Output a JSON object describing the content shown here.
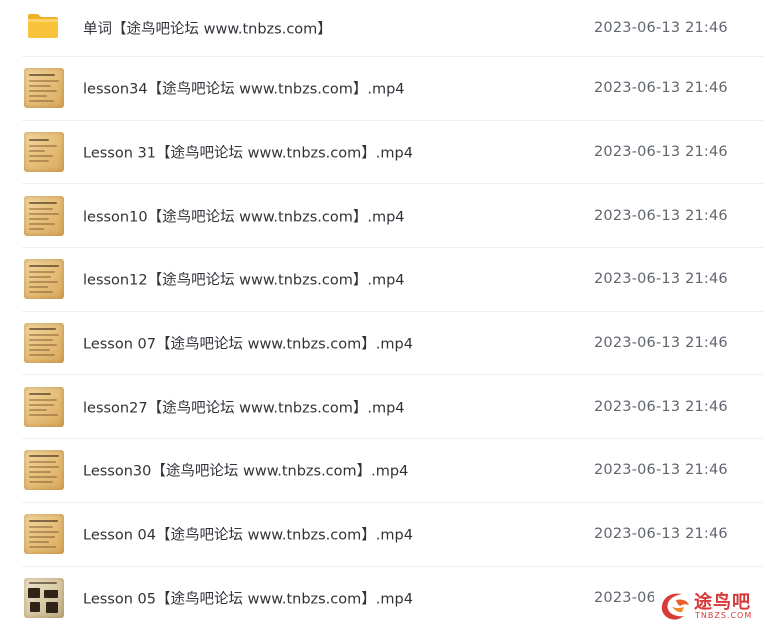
{
  "files": [
    {
      "type": "folder",
      "icon": "folder-icon",
      "name": "单词【途鸟吧论坛 www.tnbzs.com】",
      "modified": "2023-06-13 21:46"
    },
    {
      "type": "video",
      "icon": "video-thumbnail",
      "name": "lesson34【途鸟吧论坛 www.tnbzs.com】.mp4",
      "modified": "2023-06-13 21:46"
    },
    {
      "type": "video",
      "icon": "video-thumbnail",
      "name": "Lesson 31【途鸟吧论坛 www.tnbzs.com】.mp4",
      "modified": "2023-06-13 21:46"
    },
    {
      "type": "video",
      "icon": "video-thumbnail",
      "name": "lesson10【途鸟吧论坛 www.tnbzs.com】.mp4",
      "modified": "2023-06-13 21:46"
    },
    {
      "type": "video",
      "icon": "video-thumbnail",
      "name": "lesson12【途鸟吧论坛 www.tnbzs.com】.mp4",
      "modified": "2023-06-13 21:46"
    },
    {
      "type": "video",
      "icon": "video-thumbnail",
      "name": "Lesson 07【途鸟吧论坛 www.tnbzs.com】.mp4",
      "modified": "2023-06-13 21:46"
    },
    {
      "type": "video",
      "icon": "video-thumbnail",
      "name": "lesson27【途鸟吧论坛 www.tnbzs.com】.mp4",
      "modified": "2023-06-13 21:46"
    },
    {
      "type": "video",
      "icon": "video-thumbnail",
      "name": "Lesson30【途鸟吧论坛 www.tnbzs.com】.mp4",
      "modified": "2023-06-13 21:46"
    },
    {
      "type": "video",
      "icon": "video-thumbnail",
      "name": "Lesson 04【途鸟吧论坛 www.tnbzs.com】.mp4",
      "modified": "2023-06-13 21:46"
    },
    {
      "type": "video",
      "icon": "video-thumbnail",
      "name": "Lesson 05【途鸟吧论坛 www.tnbzs.com】.mp4",
      "modified": "2023-06-"
    }
  ],
  "watermark": {
    "icon": "tnbzs-logo-icon",
    "text": "途鸟吧",
    "subtext": "TNBZS.COM",
    "color": "#d83a3a"
  },
  "colors": {
    "folder": "#f8c23a",
    "row_divider": "#eef0f3",
    "name_text": "#2f3338",
    "time_text": "#60666e"
  }
}
